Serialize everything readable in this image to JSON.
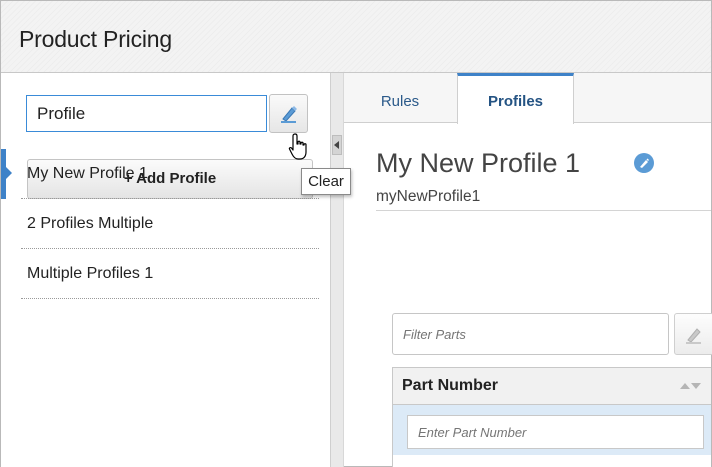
{
  "app": {
    "title": "Product Pricing"
  },
  "left_panel": {
    "search": {
      "value": "Profile",
      "placeholder": ""
    },
    "clear_tooltip": "Clear",
    "add_button_label": "+ Add Profile",
    "profiles": [
      {
        "name": "My New Profile 1",
        "selected": true
      },
      {
        "name": "2 Profiles Multiple",
        "selected": false
      },
      {
        "name": "Multiple Profiles 1",
        "selected": false
      }
    ]
  },
  "tabs": [
    {
      "label": "Rules",
      "active": false
    },
    {
      "label": "Profiles",
      "active": true
    }
  ],
  "main": {
    "title": "My New Profile 1",
    "subtitle": "myNewProfile1",
    "filter_placeholder": "Filter Parts",
    "grid": {
      "column_header": "Part Number",
      "input_placeholder": "Enter Part Number"
    }
  },
  "colors": {
    "accent": "#3e82c8",
    "selected_row": "#dceaf7",
    "header_bg": "#f3f3f3"
  },
  "icons": {
    "clear": "pencil-eraser-icon",
    "edit": "edit-pencil-icon",
    "sort": "sort-arrows-icon",
    "collapse": "collapse-left-icon",
    "cursor": "hand-pointer-icon"
  }
}
